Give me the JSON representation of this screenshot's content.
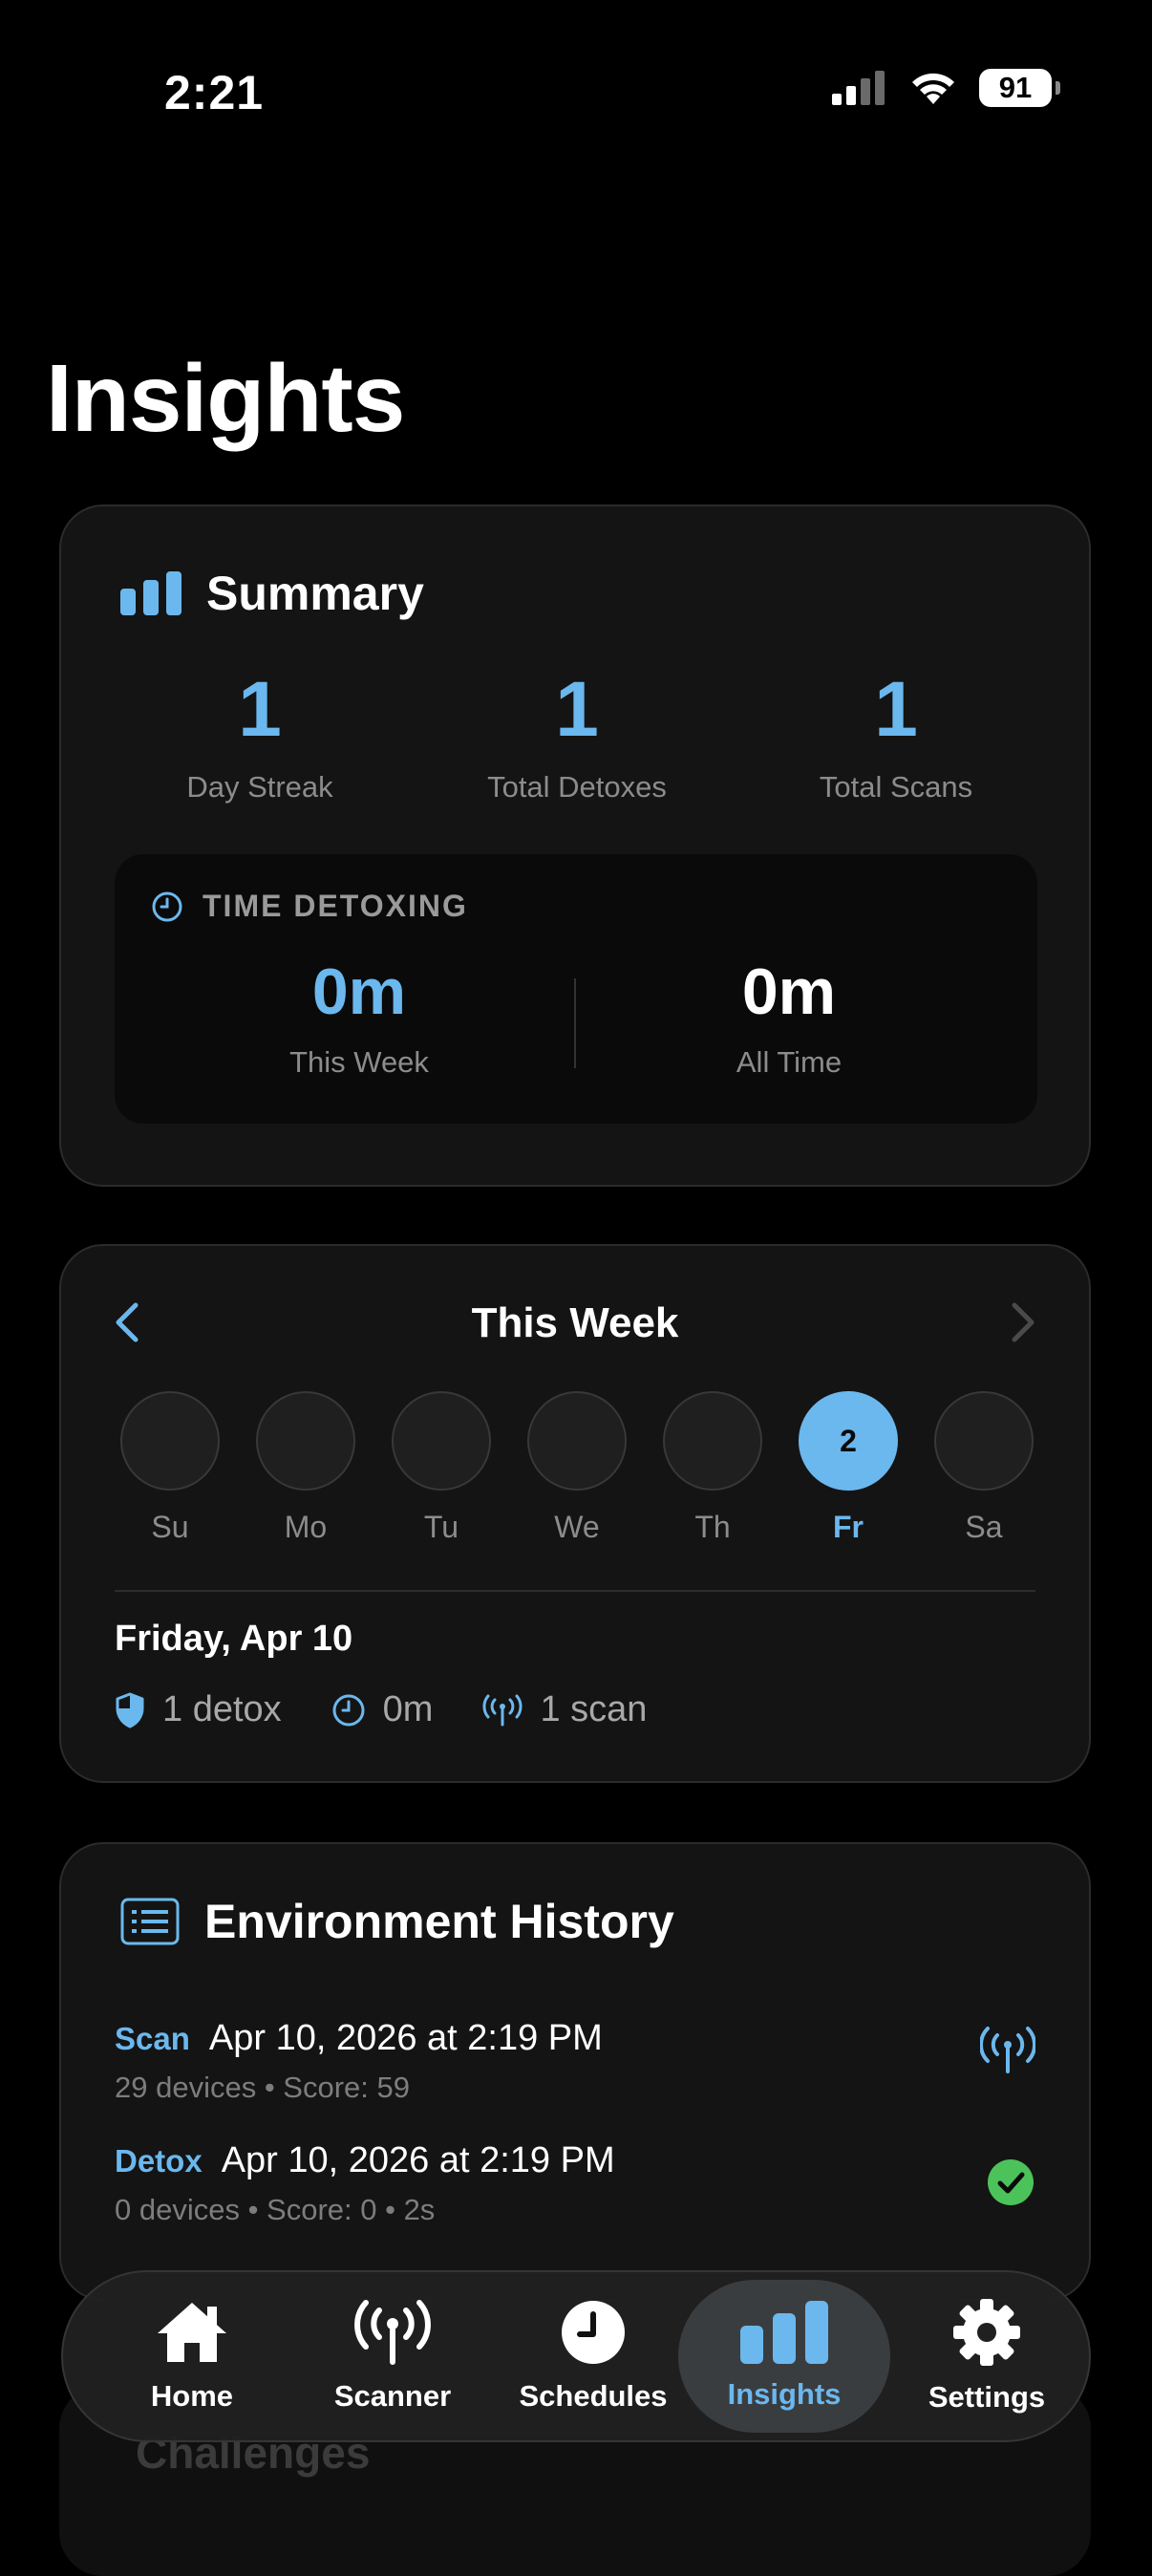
{
  "status": {
    "time": "2:21",
    "battery": "91"
  },
  "page": {
    "title": "Insights"
  },
  "summary": {
    "title": "Summary",
    "stats": [
      {
        "value": "1",
        "label": "Day Streak"
      },
      {
        "value": "1",
        "label": "Total Detoxes"
      },
      {
        "value": "1",
        "label": "Total Scans"
      }
    ],
    "time_detoxing": {
      "title": "TIME DETOXING",
      "this_week": {
        "value": "0m",
        "label": "This Week"
      },
      "all_time": {
        "value": "0m",
        "label": "All Time"
      }
    }
  },
  "week": {
    "title": "This Week",
    "days": [
      {
        "label": "Su",
        "value": ""
      },
      {
        "label": "Mo",
        "value": ""
      },
      {
        "label": "Tu",
        "value": ""
      },
      {
        "label": "We",
        "value": ""
      },
      {
        "label": "Th",
        "value": ""
      },
      {
        "label": "Fr",
        "value": "2"
      },
      {
        "label": "Sa",
        "value": ""
      }
    ],
    "selected_date": "Friday, Apr 10",
    "detox": "1 detox",
    "time": "0m",
    "scan": "1 scan"
  },
  "env_history": {
    "title": "Environment History",
    "rows": [
      {
        "type": "Scan",
        "datetime": "Apr 10, 2026 at 2:19 PM",
        "detail": "29 devices • Score: 59"
      },
      {
        "type": "Detox",
        "datetime": "Apr 10, 2026 at 2:19 PM",
        "detail": "0 devices • Score: 0 • 2s"
      }
    ]
  },
  "next_section": {
    "title": "Challenges"
  },
  "tabs": [
    {
      "label": "Home"
    },
    {
      "label": "Scanner"
    },
    {
      "label": "Schedules"
    },
    {
      "label": "Insights"
    },
    {
      "label": "Settings"
    }
  ],
  "colors": {
    "accent": "#6bb8ee",
    "success": "#4cc35a",
    "background": "#000000",
    "card": "#141414"
  }
}
